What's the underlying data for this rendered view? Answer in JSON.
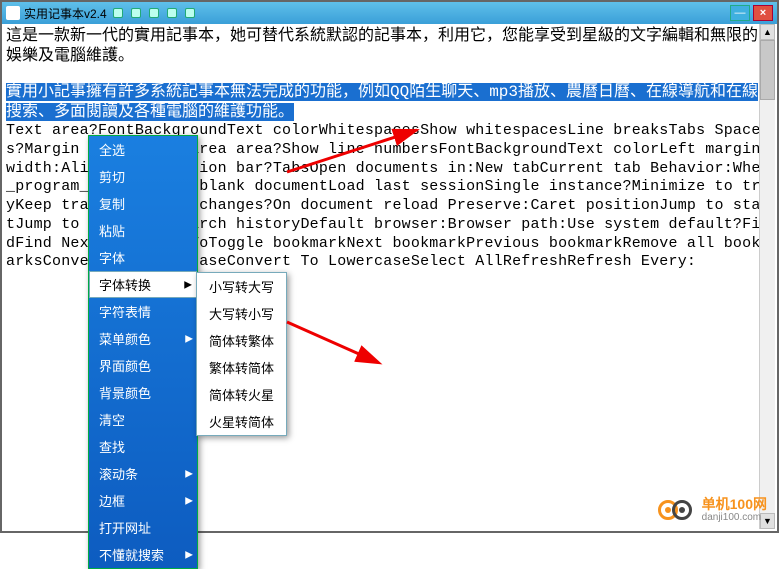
{
  "window": {
    "title": "实用记事本v2.4",
    "min": "—",
    "max": "□",
    "close": "×"
  },
  "intro": {
    "p1": "這是一款新一代的實用記事本，她可替代系統默認的記事本，利用它，您能享受到星級的文字編輯和無限的娛樂及電腦維護。",
    "p2": "實用小記事擁有許多系統記事本無法完成的功能，例如QQ陌生聊天、mp3播放、農曆日曆、在線導航和在線搜索、多面閱讀及各種電腦的維護功能。"
  },
  "body_text": "Text area?FontBackgroundText colorWhitespacesShow whitespacesLine breaksTabs Spaces?Margin line?Trans area area?Show line numbersFontBackgroundText colorLeft margin width:AlignmentSelection bar?TabsOpen documents in:New tabCurrent tab Behavior:When_program_starts:Show blank documentLoad last sessionSingle instance?Minimize to trayKeep track of outer changes?On document reload Preserve:Caret positionJump to startJump to endClear search historyDefault browser:Browser path:Use system default?FindFind NextReplaceGo ToToggle bookmarkNext bookmarkPrevious bookmarkRemove all bookmarksConvert To UppercaseConvert To LowercaseSelect AllRefreshRefresh Every:",
  "menu": {
    "items": [
      {
        "label": "全选",
        "arrow": false
      },
      {
        "label": "剪切",
        "arrow": false
      },
      {
        "label": "复制",
        "arrow": false
      },
      {
        "label": "粘贴",
        "arrow": false
      },
      {
        "label": "字体",
        "arrow": false
      },
      {
        "label": "字体转换",
        "arrow": true,
        "hover": true
      },
      {
        "label": "字符表情",
        "arrow": false
      },
      {
        "label": "菜单颜色",
        "arrow": true
      },
      {
        "label": "界面颜色",
        "arrow": false
      },
      {
        "label": "背景颜色",
        "arrow": false
      },
      {
        "label": "清空",
        "arrow": false
      },
      {
        "label": "查找",
        "arrow": false
      },
      {
        "label": "滚动条",
        "arrow": true
      },
      {
        "label": "边框",
        "arrow": true
      },
      {
        "label": "打开网址",
        "arrow": false
      },
      {
        "label": "不懂就搜索",
        "arrow": true
      }
    ]
  },
  "submenu": {
    "items": [
      "小写转大写",
      "大写转小写",
      "简体转繁体",
      "繁体转简体",
      "简体转火星",
      "火星转简体"
    ]
  },
  "watermark": {
    "line1": "单机100网",
    "line2": "danji100.com"
  }
}
